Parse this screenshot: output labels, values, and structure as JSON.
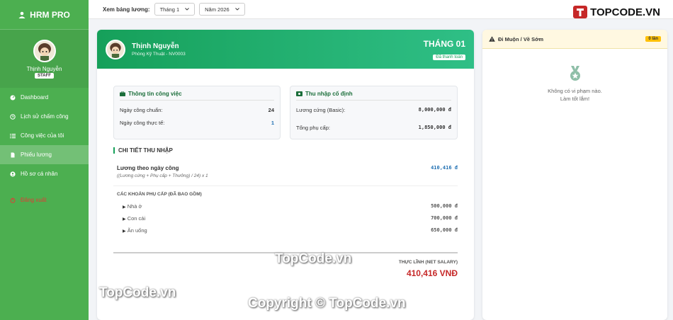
{
  "app": {
    "title": "HRM PRO"
  },
  "user": {
    "name": "Thịnh Nguyễn",
    "role": "STAFF"
  },
  "menu": [
    {
      "label": "Dashboard",
      "icon": "dashboard-icon"
    },
    {
      "label": "Lịch sử chấm công",
      "icon": "history-icon"
    },
    {
      "label": "Công việc của tôi",
      "icon": "tasks-icon"
    },
    {
      "label": "Phiếu lương",
      "icon": "payslip-icon",
      "active": true
    },
    {
      "label": "Hồ sơ cá nhân",
      "icon": "profile-icon"
    },
    {
      "label": "Đăng xuất",
      "icon": "logout-icon"
    }
  ],
  "filter": {
    "label": "Xem bảng lương:",
    "month": "Tháng 1",
    "year": "Năm 2026"
  },
  "logo": {
    "text": "TOPCODE.VN"
  },
  "payslip": {
    "name": "Thịnh Nguyễn",
    "dept": "Phòng Kỹ Thuật - NV0003",
    "month": "THÁNG 01",
    "status": "Đã thanh toán",
    "work": {
      "title": "Thông tin công việc",
      "std_label": "Ngày công chuẩn:",
      "std_value": "24",
      "actual_label": "Ngày công thực tế:",
      "actual_value": "1"
    },
    "income": {
      "title": "Thu nhập cố định",
      "basic_label": "Lương cứng (Basic):",
      "basic_value": "8,000,000 đ",
      "allow_label": "Tổng phụ cấp:",
      "allow_value": "1,850,000 đ"
    },
    "detail_title": "CHI TIẾT THU NHẬP",
    "salary_label": "Lương theo ngày công",
    "salary_formula": "((Lương cứng + Phụ cấp + Thưởng) / 24) x 1",
    "salary_value": "410,416 đ",
    "allowances_title": "CÁC KHOẢN PHỤ CẤP (ĐÃ BAO GỒM)",
    "allowances": [
      {
        "label": "Nhà ở",
        "value": "500,000 đ"
      },
      {
        "label": "Con cái",
        "value": "700,000 đ"
      },
      {
        "label": "Ăn uống",
        "value": "650,000 đ"
      }
    ],
    "net_label": "THỰC LĨNH (NET SALARY)",
    "net_value": "410,416 VNĐ"
  },
  "violations": {
    "title": "Đi Muộn / Về Sớm",
    "count": "0 lần",
    "empty_line1": "Không có vi phạm nào.",
    "empty_line2": "Làm tốt lắm!"
  },
  "watermarks": [
    "TopCode.vn",
    "TopCode.vn",
    "Copyright © TopCode.vn"
  ],
  "colors": {
    "sidebar": "#4caf50",
    "header_gradient_start": "#16a05a",
    "net": "#c62828",
    "accent_blue": "#1f6fb2"
  }
}
